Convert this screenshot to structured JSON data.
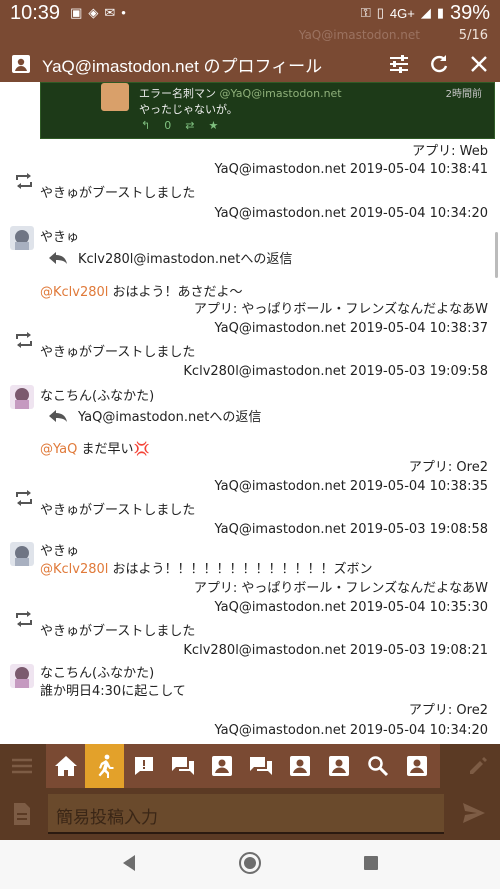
{
  "status_bar": {
    "time": "10:39",
    "network": "4G+",
    "battery": "39%"
  },
  "header": {
    "title": "YaQ@imastodon.net のプロフィール",
    "ghost_text": "YaQ@imastodon.net",
    "page_counter": "5/16"
  },
  "embedded_card": {
    "name": "エラー名刺マン",
    "handle": "@YaQ@imastodon.net",
    "time_ago": "2時間前",
    "text": "やったじゃないが。",
    "fav_count": "0"
  },
  "timeline": {
    "app_web": "アプリ: Web",
    "boost1_meta": "YaQ@imastodon.net 2019-05-04 10:38:41",
    "boost_text": "やきゅがブーストしました",
    "post1_meta": "YaQ@imastodon.net 2019-05-04 10:34:20",
    "yakyu_name": "やきゅ",
    "reply_to_kclv": "Kclv280l@imastodon.netへの返信",
    "post1_mention": "@Kclv280l",
    "post1_text": "おはよう！あさだよ～",
    "app_yappari": "アプリ: やっぱりボール・フレンズなんだよなあW",
    "boost2_meta": "YaQ@imastodon.net 2019-05-04 10:38:37",
    "post2_meta": "Kclv280l@imastodon.net 2019-05-03 19:09:58",
    "nako_name": "なこちん(ふなかた)",
    "reply_to_yaq": "YaQ@imastodon.netへの返信",
    "post2_mention": "@YaQ",
    "post2_text": "まだ早い💢",
    "app_ore2": "アプリ: Ore2",
    "boost3_meta": "YaQ@imastodon.net 2019-05-04 10:38:35",
    "post3_meta": "YaQ@imastodon.net 2019-05-03 19:08:58",
    "post3_mention": "@Kclv280l",
    "post3_text": "おはよう！！！！！！！！！！！！！ズボン",
    "boost4_meta": "YaQ@imastodon.net 2019-05-04 10:35:30",
    "post4_meta": "Kclv280l@imastodon.net 2019-05-03 19:08:21",
    "post4_text": "誰か明日4:30に起こして",
    "boost5_meta": "YaQ@imastodon.net 2019-05-04 10:34:20"
  },
  "tabs": [
    "home-icon",
    "local-timeline-icon",
    "notifications-icon",
    "conversation-icon",
    "profile-icon",
    "conversation-icon",
    "profile-icon",
    "profile-icon",
    "search-icon",
    "profile-icon"
  ],
  "compose": {
    "placeholder": "簡易投稿入力"
  },
  "colors": {
    "header": "#7a4a33",
    "tab_active": "#e3a12a",
    "mention": "#e07a3a"
  }
}
